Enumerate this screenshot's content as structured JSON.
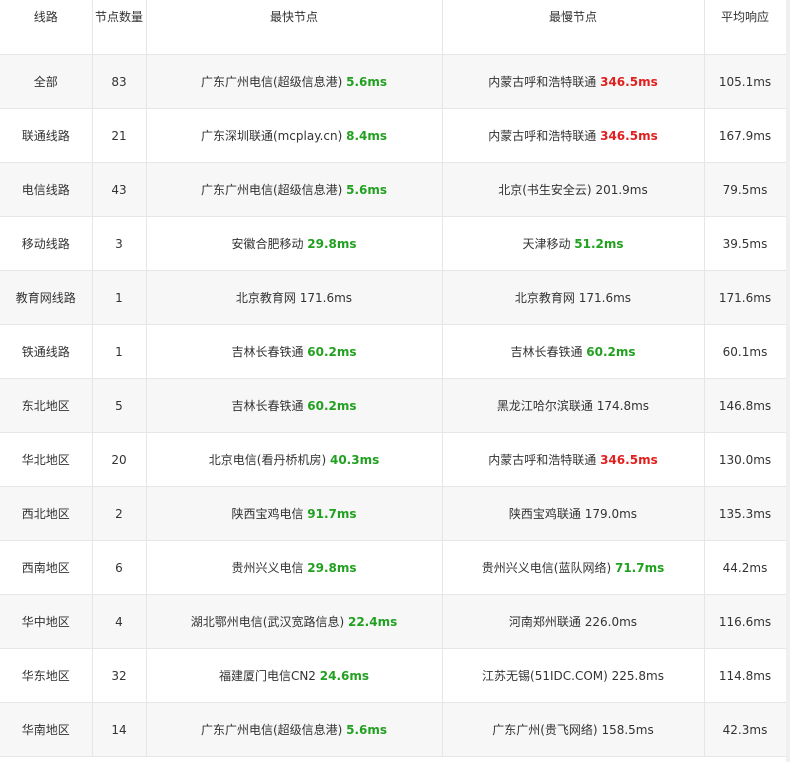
{
  "headers": {
    "route": "线路",
    "count": "节点数量",
    "fastest": "最快节点",
    "slowest": "最慢节点",
    "average": "平均响应"
  },
  "colors": {
    "fast": "#22a020",
    "slow": "#e0201e"
  },
  "rows": [
    {
      "route": "全部",
      "count": "83",
      "fast_node": "广东广州电信(超级信息港)",
      "fast_ms": "5.6ms",
      "fast_style": "fast",
      "slow_node": "内蒙古呼和浩特联通",
      "slow_ms": "346.5ms",
      "slow_style": "slow",
      "avg": "105.1ms"
    },
    {
      "route": "联通线路",
      "count": "21",
      "fast_node": "广东深圳联通(mcplay.cn)",
      "fast_ms": "8.4ms",
      "fast_style": "fast",
      "slow_node": "内蒙古呼和浩特联通",
      "slow_ms": "346.5ms",
      "slow_style": "slow",
      "avg": "167.9ms"
    },
    {
      "route": "电信线路",
      "count": "43",
      "fast_node": "广东广州电信(超级信息港)",
      "fast_ms": "5.6ms",
      "fast_style": "fast",
      "slow_node": "北京(书生安全云)",
      "slow_ms": "201.9ms",
      "slow_style": "plain",
      "avg": "79.5ms"
    },
    {
      "route": "移动线路",
      "count": "3",
      "fast_node": "安徽合肥移动",
      "fast_ms": "29.8ms",
      "fast_style": "fast",
      "slow_node": "天津移动",
      "slow_ms": "51.2ms",
      "slow_style": "fast",
      "avg": "39.5ms"
    },
    {
      "route": "教育网线路",
      "count": "1",
      "fast_node": "北京教育网",
      "fast_ms": "171.6ms",
      "fast_style": "plain",
      "slow_node": "北京教育网",
      "slow_ms": "171.6ms",
      "slow_style": "plain",
      "avg": "171.6ms"
    },
    {
      "route": "铁通线路",
      "count": "1",
      "fast_node": "吉林长春铁通",
      "fast_ms": "60.2ms",
      "fast_style": "fast",
      "slow_node": "吉林长春铁通",
      "slow_ms": "60.2ms",
      "slow_style": "fast",
      "avg": "60.1ms"
    },
    {
      "route": "东北地区",
      "count": "5",
      "fast_node": "吉林长春铁通",
      "fast_ms": "60.2ms",
      "fast_style": "fast",
      "slow_node": "黑龙江哈尔滨联通",
      "slow_ms": "174.8ms",
      "slow_style": "plain",
      "avg": "146.8ms"
    },
    {
      "route": "华北地区",
      "count": "20",
      "fast_node": "北京电信(看丹桥机房)",
      "fast_ms": "40.3ms",
      "fast_style": "fast",
      "slow_node": "内蒙古呼和浩特联通",
      "slow_ms": "346.5ms",
      "slow_style": "slow",
      "avg": "130.0ms"
    },
    {
      "route": "西北地区",
      "count": "2",
      "fast_node": "陕西宝鸡电信",
      "fast_ms": "91.7ms",
      "fast_style": "fast",
      "slow_node": "陕西宝鸡联通",
      "slow_ms": "179.0ms",
      "slow_style": "plain",
      "avg": "135.3ms"
    },
    {
      "route": "西南地区",
      "count": "6",
      "fast_node": "贵州兴义电信",
      "fast_ms": "29.8ms",
      "fast_style": "fast",
      "slow_node": "贵州兴义电信(蓝队网络)",
      "slow_ms": "71.7ms",
      "slow_style": "fast",
      "avg": "44.2ms"
    },
    {
      "route": "华中地区",
      "count": "4",
      "fast_node": "湖北鄂州电信(武汉宽路信息)",
      "fast_ms": "22.4ms",
      "fast_style": "fast",
      "slow_node": "河南郑州联通",
      "slow_ms": "226.0ms",
      "slow_style": "plain",
      "avg": "116.6ms"
    },
    {
      "route": "华东地区",
      "count": "32",
      "fast_node": "福建厦门电信CN2",
      "fast_ms": "24.6ms",
      "fast_style": "fast",
      "slow_node": "江苏无锡(51IDC.COM)",
      "slow_ms": "225.8ms",
      "slow_style": "plain",
      "avg": "114.8ms"
    },
    {
      "route": "华南地区",
      "count": "14",
      "fast_node": "广东广州电信(超级信息港)",
      "fast_ms": "5.6ms",
      "fast_style": "fast",
      "slow_node": "广东广州(贵飞网络)",
      "slow_ms": "158.5ms",
      "slow_style": "plain",
      "avg": "42.3ms"
    }
  ]
}
